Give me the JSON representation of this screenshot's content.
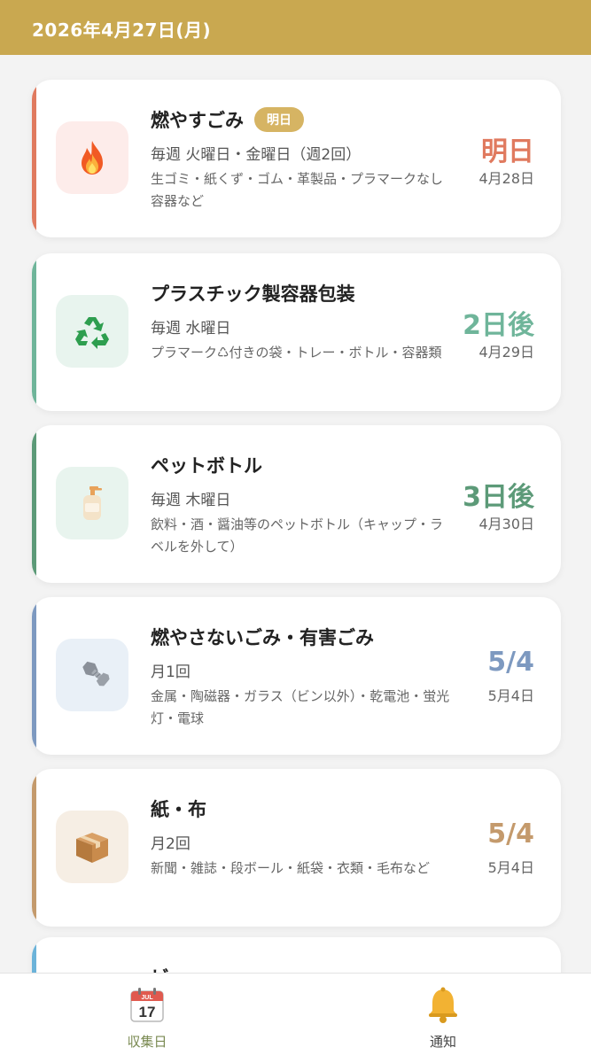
{
  "header": {
    "date_title": "2026年4月27日(月)"
  },
  "cards": [
    {
      "title": "燃やすごみ",
      "badge": "明日",
      "schedule": "毎週 火曜日・金曜日（週2回）",
      "description": "生ゴミ・紙くず・ゴム・革製品・プラマークなし容器など",
      "when": "明日",
      "date": "4月28日",
      "icon": "fire-icon",
      "accent": "#e07a5f",
      "when_color": "#e07a5f",
      "icon_bg": "#fdecea"
    },
    {
      "title": "プラスチック製容器包装",
      "schedule": "毎週 水曜日",
      "description": "プラマーク♺付きの袋・トレー・ボトル・容器類",
      "when": "2日後",
      "date": "4月29日",
      "icon": "recycle-icon",
      "accent": "#6fb59a",
      "when_color": "#6fb59a",
      "icon_bg": "#e8f4ee"
    },
    {
      "title": "ペットボトル",
      "schedule": "毎週 木曜日",
      "description": "飲料・酒・醤油等のペットボトル（キャップ・ラベルを外して）",
      "when": "3日後",
      "date": "4月30日",
      "icon": "bottle-icon",
      "accent": "#5c9a78",
      "when_color": "#5c9a78",
      "icon_bg": "#e8f4ee"
    },
    {
      "title": "燃やさないごみ・有害ごみ",
      "schedule": "月1回",
      "description": "金属・陶磁器・ガラス（ビン以外）・乾電池・蛍光灯・電球",
      "when": "5/4",
      "date": "5月4日",
      "icon": "bolt-nut-icon",
      "accent": "#7d99c0",
      "when_color": "#7d99c0",
      "icon_bg": "#e9f0f7"
    },
    {
      "title": "紙・布",
      "schedule": "月2回",
      "description": "新聞・雑誌・段ボール・紙袋・衣類・毛布など",
      "when": "5/4",
      "date": "5月4日",
      "icon": "cardboard-box-icon",
      "accent": "#c49a6c",
      "when_color": "#c49a6c",
      "icon_bg": "#f6eee4"
    },
    {
      "title": "ビ",
      "schedule": "",
      "description": "",
      "when": "",
      "date": "",
      "icon": "",
      "accent": "#6bb3d9",
      "when_color": "#6bb3d9",
      "icon_bg": "#e8f3fa"
    }
  ],
  "tabbar": {
    "tabs": [
      {
        "label": "収集日",
        "icon": "calendar-icon",
        "calendar_month": "JUL",
        "calendar_day": "17",
        "active": true
      },
      {
        "label": "通知",
        "icon": "bell-icon",
        "active": false
      }
    ]
  }
}
